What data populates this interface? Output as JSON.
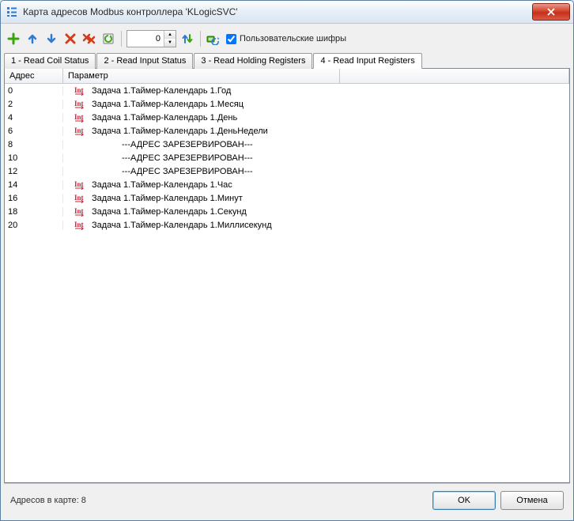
{
  "window": {
    "title": "Карта адресов Modbus контроллера 'KLogicSVC'"
  },
  "toolbar": {
    "spinner_value": "0",
    "checkbox_label": "Пользовательские шифры",
    "checkbox_checked": true
  },
  "tabs": [
    {
      "label": "1 - Read Coil Status",
      "active": false
    },
    {
      "label": "2 - Read Input Status",
      "active": false
    },
    {
      "label": "3 - Read Holding Registers",
      "active": false
    },
    {
      "label": "4 - Read Input Registers",
      "active": true
    }
  ],
  "grid": {
    "header_addr": "Адрес",
    "header_param": "Параметр",
    "rows": [
      {
        "addr": "0",
        "type": "int",
        "param": "Задача 1.Таймер-Календарь 1.Год"
      },
      {
        "addr": "2",
        "type": "int",
        "param": "Задача 1.Таймер-Календарь 1.Месяц"
      },
      {
        "addr": "4",
        "type": "int",
        "param": "Задача 1.Таймер-Календарь 1.День"
      },
      {
        "addr": "6",
        "type": "int",
        "param": "Задача 1.Таймер-Календарь 1.ДеньНедели"
      },
      {
        "addr": "8",
        "type": "reserved",
        "param": "---АДРЕС  ЗАРЕЗЕРВИРОВАН---"
      },
      {
        "addr": "10",
        "type": "reserved",
        "param": "---АДРЕС  ЗАРЕЗЕРВИРОВАН---"
      },
      {
        "addr": "12",
        "type": "reserved",
        "param": "---АДРЕС  ЗАРЕЗЕРВИРОВАН---"
      },
      {
        "addr": "14",
        "type": "int",
        "param": "Задача 1.Таймер-Календарь 1.Час"
      },
      {
        "addr": "16",
        "type": "int",
        "param": "Задача 1.Таймер-Календарь 1.Минут"
      },
      {
        "addr": "18",
        "type": "int",
        "param": "Задача 1.Таймер-Календарь 1.Секунд"
      },
      {
        "addr": "20",
        "type": "int",
        "param": "Задача 1.Таймер-Календарь 1.Миллисекунд"
      }
    ]
  },
  "status": {
    "text": "Адресов в карте: 8",
    "ok": "OK",
    "cancel": "Отмена"
  },
  "colors": {
    "accent_green": "#3aa40e",
    "accent_blue": "#2f7bd4",
    "accent_red": "#d23d1a"
  }
}
